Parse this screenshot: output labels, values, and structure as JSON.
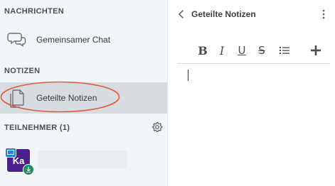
{
  "sidebar": {
    "messages_header": "NACHRICHTEN",
    "shared_chat_label": "Gemeinsamer Chat",
    "notes_header": "NOTIZEN",
    "shared_notes_label": "Geteilte Notizen",
    "participants_header": "TEILNEHMER (1)",
    "user_avatar_initials": "Ka"
  },
  "panel": {
    "title": "Geteilte Notizen"
  },
  "toolbar": {
    "bold_label": "B",
    "italic_label": "I",
    "underline_label": "U",
    "strike_label": "S"
  },
  "colors": {
    "sidebar_bg": "#f3f6f9",
    "active_item_bg": "#d8dce1",
    "highlight_ellipse": "#e05a3f",
    "avatar_bg": "#4b1f8c",
    "presenter_badge": "#2a7fd6",
    "moderator_badge": "#1a8e63"
  },
  "icons": {
    "chat": "chat-bubbles-icon",
    "notes": "documents-icon",
    "settings": "gear-icon",
    "back": "chevron-left-icon",
    "more": "kebab-menu-icon",
    "list": "list-icon",
    "add": "plus-icon"
  }
}
